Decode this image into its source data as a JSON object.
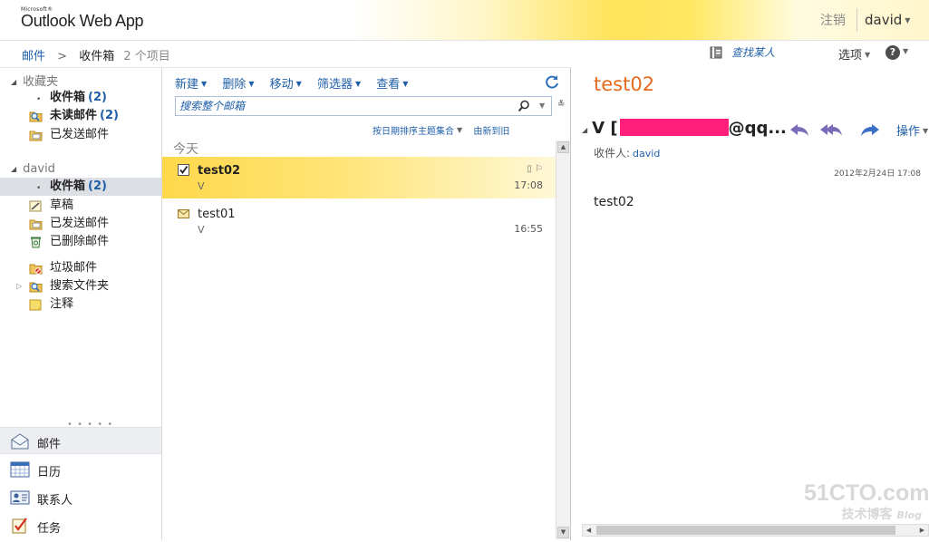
{
  "header": {
    "logo_small": "Microsoft®",
    "logo_name": "Outlook Web App",
    "signout_label": "注销",
    "user_name": "david"
  },
  "breadcrumb": {
    "root": "邮件",
    "current": "收件箱",
    "count": "2 个项目"
  },
  "top_actions": {
    "find_contact": "查找某人",
    "options_label": "选项",
    "help_symbol": "?"
  },
  "nav": {
    "favorites_title": "收藏夹",
    "favorites": [
      {
        "label": "收件箱",
        "count": "(2)",
        "icon": "inbox-icon"
      },
      {
        "label": "未读邮件",
        "count": "(2)",
        "icon": "search-folder-icon"
      },
      {
        "label": "已发送邮件",
        "count": "",
        "icon": "sent-icon"
      }
    ],
    "mailbox_title": "david",
    "folders": [
      {
        "label": "收件箱",
        "count": "(2)",
        "icon": "inbox-icon"
      },
      {
        "label": "草稿",
        "count": "",
        "icon": "drafts-icon"
      },
      {
        "label": "已发送邮件",
        "count": "",
        "icon": "sent-icon"
      },
      {
        "label": "已删除邮件",
        "count": "",
        "icon": "deleted-icon"
      },
      {
        "label": "垃圾邮件",
        "count": "",
        "icon": "junk-icon"
      },
      {
        "label": "搜索文件夹",
        "count": "",
        "icon": "search-folder-icon"
      },
      {
        "label": "注释",
        "count": "",
        "icon": "notes-icon"
      }
    ],
    "dots": "• • • • •",
    "modules": [
      {
        "label": "邮件",
        "icon": "mail-icon"
      },
      {
        "label": "日历",
        "icon": "calendar-icon"
      },
      {
        "label": "联系人",
        "icon": "contacts-icon"
      },
      {
        "label": "任务",
        "icon": "tasks-icon"
      }
    ]
  },
  "list": {
    "toolbar": [
      "新建",
      "删除",
      "移动",
      "筛选器",
      "查看"
    ],
    "search_placeholder": "搜索整个邮箱",
    "sort_by": "按日期排序主题集合",
    "sort_order": "由新到旧",
    "group_header": "今天",
    "messages": [
      {
        "subject": "test02",
        "sender": "V",
        "time": "17:08",
        "selected": true,
        "unread": true
      },
      {
        "subject": "test01",
        "sender": "V",
        "time": "16:55",
        "selected": false,
        "unread": false
      }
    ]
  },
  "reading": {
    "subject": "test02",
    "from_prefix": "V [",
    "from_suffix": "@qq...",
    "actions_label": "操作",
    "to_label": "收件人:",
    "to_name": "david",
    "date": "2012年2月24日  17:08",
    "body": "test02"
  },
  "watermark": {
    "main": "51CTO.com",
    "sub": "技术博客",
    "blog": "Blog"
  },
  "colors": {
    "accent_orange": "#e56b1f",
    "link_blue": "#1f5fa8",
    "selection_yellow": "#ffd84a",
    "redaction_pink": "#ff1f7a"
  }
}
